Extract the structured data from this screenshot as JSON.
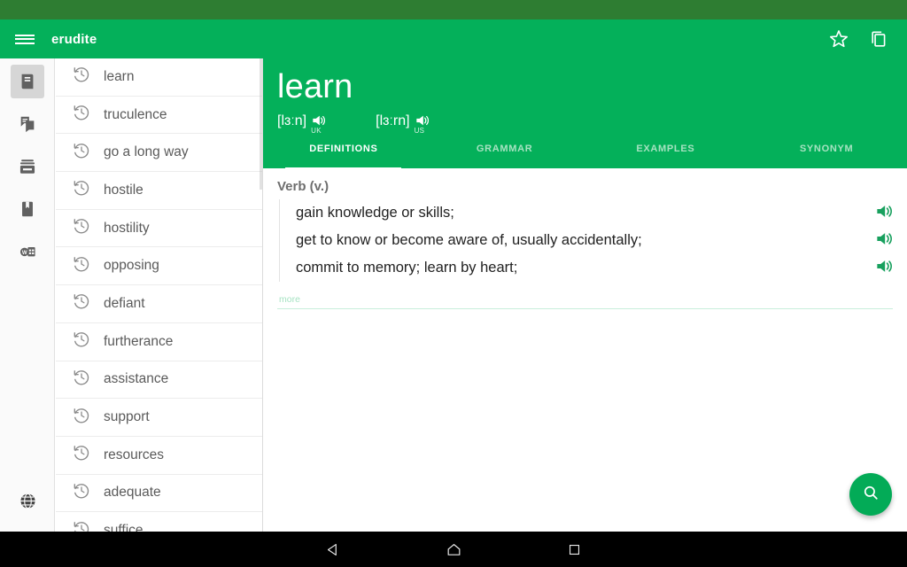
{
  "app": {
    "title": "erudite",
    "menu_icon": "hamburger-menu-icon",
    "favorite_icon": "star-outline-icon",
    "copy_icon": "copy-icon",
    "accent_green": "#04b05a",
    "status_bar_green": "#2e7d32"
  },
  "rail": {
    "items": [
      {
        "name": "dictionary",
        "icon": "book-icon",
        "active": true
      },
      {
        "name": "translation",
        "icon": "note-page-icon",
        "active": false
      },
      {
        "name": "cards",
        "icon": "cards-icon",
        "active": false
      },
      {
        "name": "bookmarks",
        "icon": "bookmark-book-icon",
        "active": false
      },
      {
        "name": "wikipedia",
        "icon": "wikipedia-icon",
        "active": false
      }
    ],
    "bottom": {
      "name": "web",
      "icon": "globe-icon"
    }
  },
  "wordlist": {
    "item_icon": "history-clock-icon",
    "items": [
      "learn",
      "truculence",
      "go a long way",
      "hostile",
      "hostility",
      "opposing",
      "defiant",
      "furtherance",
      "assistance",
      "support",
      "resources",
      "adequate",
      "suffice"
    ]
  },
  "entry": {
    "headword": "learn",
    "pronunciations": [
      {
        "ipa": "[lɜːn]",
        "variant": "UK",
        "speaker_icon": "speaker-icon"
      },
      {
        "ipa": "[lɜːrn]",
        "variant": "US",
        "speaker_icon": "speaker-icon"
      }
    ],
    "tabs": [
      {
        "label": "DEFINITIONS",
        "active": true
      },
      {
        "label": "GRAMMAR",
        "active": false
      },
      {
        "label": "EXAMPLES",
        "active": false
      },
      {
        "label": "SYNONYM",
        "active": false
      }
    ],
    "part_of_speech": "Verb (v.)",
    "definitions": [
      "gain knowledge or skills;",
      "get to know or become aware of, usually accidentally;",
      "commit to memory; learn by heart;"
    ],
    "definition_speaker_icon": "speaker-icon",
    "more_label": "more"
  },
  "fab": {
    "icon": "search-icon"
  },
  "navbar": {
    "back": "back-triangle-icon",
    "home": "home-icon",
    "recents": "recents-square-icon"
  }
}
